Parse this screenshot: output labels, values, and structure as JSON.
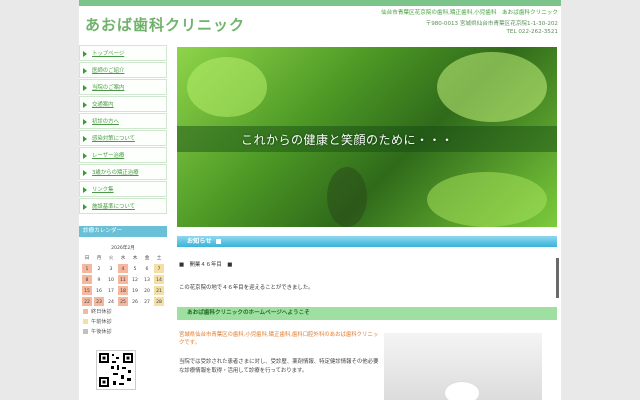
{
  "site": {
    "logo": "あおば歯科クリニック"
  },
  "header": {
    "line1": "仙台市青葉区花京院の歯科,矯正歯科,小児歯科　あおば歯科クリニック",
    "address": "〒980-0013 宮城県仙台市青葉区花京院1-1-30-202",
    "tel": "TEL 022-262-3521"
  },
  "nav": {
    "items": [
      {
        "label": "トップページ"
      },
      {
        "label": "医師のご紹介"
      },
      {
        "label": "当院のご案内"
      },
      {
        "label": "交通案内"
      },
      {
        "label": "初診の方へ"
      },
      {
        "label": "感染対策について"
      },
      {
        "label": "レーザー治療"
      },
      {
        "label": "3歳からの矯正治療"
      },
      {
        "label": "リンク集"
      },
      {
        "label": "施設基準について"
      }
    ]
  },
  "calendar": {
    "header": "診療カレンダー",
    "title": "2026年2月",
    "weekdays": [
      "日",
      "月",
      "火",
      "水",
      "木",
      "金",
      "土"
    ],
    "weeks": [
      [
        {
          "d": "1",
          "s": "hol"
        },
        {
          "d": "2",
          "s": ""
        },
        {
          "d": "3",
          "s": ""
        },
        {
          "d": "4",
          "s": "hol"
        },
        {
          "d": "5",
          "s": ""
        },
        {
          "d": "6",
          "s": ""
        },
        {
          "d": "7",
          "s": "am"
        }
      ],
      [
        {
          "d": "8",
          "s": "hol"
        },
        {
          "d": "9",
          "s": ""
        },
        {
          "d": "10",
          "s": ""
        },
        {
          "d": "11",
          "s": "hol"
        },
        {
          "d": "12",
          "s": ""
        },
        {
          "d": "13",
          "s": ""
        },
        {
          "d": "14",
          "s": "am"
        }
      ],
      [
        {
          "d": "15",
          "s": "hol"
        },
        {
          "d": "16",
          "s": ""
        },
        {
          "d": "17",
          "s": ""
        },
        {
          "d": "18",
          "s": "hol"
        },
        {
          "d": "19",
          "s": ""
        },
        {
          "d": "20",
          "s": ""
        },
        {
          "d": "21",
          "s": "am"
        }
      ],
      [
        {
          "d": "22",
          "s": "hol"
        },
        {
          "d": "23",
          "s": "hol"
        },
        {
          "d": "24",
          "s": ""
        },
        {
          "d": "25",
          "s": "hol"
        },
        {
          "d": "26",
          "s": ""
        },
        {
          "d": "27",
          "s": ""
        },
        {
          "d": "28",
          "s": "am"
        }
      ]
    ],
    "legend": {
      "closed": "終日休診",
      "am": "午前休診",
      "pm": "午後休診"
    }
  },
  "hero": {
    "caption": "これからの健康と笑顔のために・・・"
  },
  "news": {
    "header": "お知らせ",
    "item_title": "■　開業４６年目　■",
    "item_body": "この花京院の地で４６年目を迎えることができました。"
  },
  "welcome": {
    "header": "あおば歯科クリニックのホームページへようこそ",
    "title": "宮城県仙台市青葉区の歯科,小児歯科,矯正歯科,歯科口腔外科のあおば歯科クリニックです。",
    "body": "当院では受診された患者さまに対し、受診歴、薬剤情報、特定健診情報その他必要な診療情報を取得・活用して診療を行っております。"
  },
  "colors": {
    "accent": "#4a9b44",
    "sky": "#39b2d8",
    "holiday": "#f6b79f",
    "am": "#f4dfa6",
    "pm": "#c0c0c0"
  }
}
